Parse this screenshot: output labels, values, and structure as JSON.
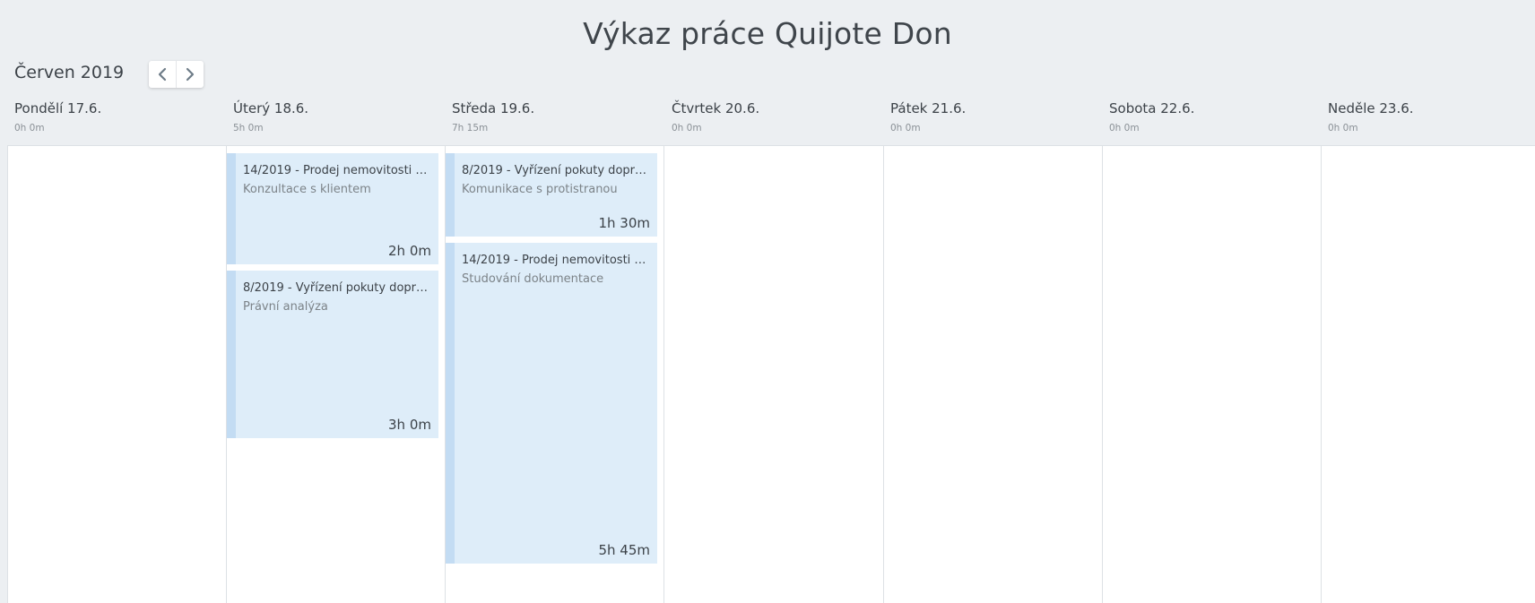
{
  "title": "Výkaz práce Quijote Don",
  "period": {
    "label": "Červen 2019"
  },
  "nav": {
    "prev_icon": "chevron-left-icon",
    "next_icon": "chevron-right-icon"
  },
  "days": [
    {
      "name": "Pondělí 17.6.",
      "total": "0h 0m"
    },
    {
      "name": "Úterý 18.6.",
      "total": "5h 0m"
    },
    {
      "name": "Středa 19.6.",
      "total": "7h 15m"
    },
    {
      "name": "Čtvrtek 20.6.",
      "total": "0h 0m"
    },
    {
      "name": "Pátek 21.6.",
      "total": "0h 0m"
    },
    {
      "name": "Sobota 22.6.",
      "total": "0h 0m"
    },
    {
      "name": "Neděle 23.6.",
      "total": "0h 0m"
    }
  ],
  "entries": {
    "tue": [
      {
        "title": "14/2019 - Prodej nemovitosti 3...",
        "activity": "Konzultace s klientem",
        "duration": "2h 0m"
      },
      {
        "title": "8/2019 - Vyřízení pokuty doprav...",
        "activity": "Právní analýza",
        "duration": "3h 0m"
      }
    ],
    "wed": [
      {
        "title": "8/2019 - Vyřízení pokuty doprav...",
        "activity": "Komunikace s protistranou",
        "duration": "1h 30m"
      },
      {
        "title": "14/2019 - Prodej nemovitosti 3...",
        "activity": "Studování dokumentace",
        "duration": "5h 45m"
      }
    ]
  },
  "colors": {
    "background": "#eceff2",
    "event_fill": "#deedf9",
    "event_stripe": "#c3dcf3"
  }
}
